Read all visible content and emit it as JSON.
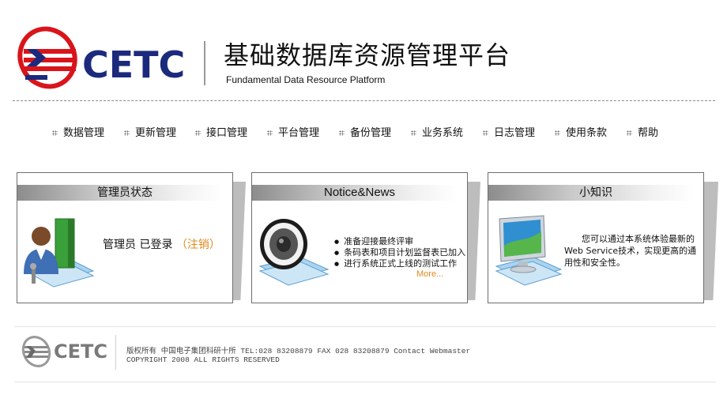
{
  "header": {
    "logo_text": "CETC",
    "title_cn": "基础数据库资源管理平台",
    "title_en": "Fundamental Data Resource Platform"
  },
  "nav": {
    "items": [
      "数据管理",
      "更新管理",
      "接口管理",
      "平台管理",
      "备份管理",
      "业务系统",
      "日志管理",
      "使用条款",
      "帮助"
    ]
  },
  "panels": {
    "admin": {
      "title": "管理员状态",
      "status": "管理员 已登录",
      "logout": "（注销）",
      "icon": "admin-user-icon"
    },
    "news": {
      "title": "Notice&News",
      "items": [
        "准备迎接最终评审",
        "条码表和项目计划监督表已加入",
        "进行系统正式上线的测试工作"
      ],
      "more": "More...",
      "icon": "speaker-icon"
    },
    "tips": {
      "title": "小知识",
      "text": "您可以通过本系统体验最新的Web Service技术，实现更高的通用性和安全性。",
      "icon": "monitor-icon"
    }
  },
  "footer": {
    "logo_text": "CETC",
    "line1_prefix": "版权所有 中国电子集团科研十所 TEL:028 83208879 FAX 028 83208879 Contact ",
    "webmaster": "Webmaster",
    "line2": "COPYRIGHT 2008 ALL RIGHTS RESERVED"
  },
  "colors": {
    "brand_blue": "#1b2a7c",
    "brand_red": "#d9141b",
    "accent_orange": "#e08a1c"
  }
}
